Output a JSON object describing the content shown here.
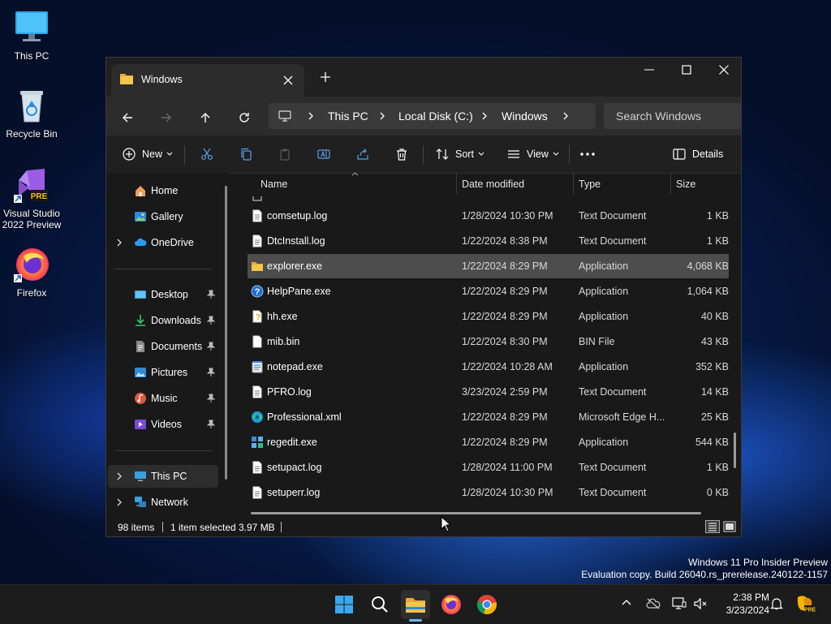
{
  "desktop": {
    "icons": [
      {
        "label": "This PC"
      },
      {
        "label": "Recycle Bin"
      },
      {
        "label": "Visual Studio 2022 Preview"
      },
      {
        "label": "Firefox"
      }
    ],
    "watermark_line1": "Windows 11 Pro Insider Preview",
    "watermark_line2": "Evaluation copy. Build 26040.rs_prerelease.240122-1157"
  },
  "window": {
    "tab_title": "Windows",
    "breadcrumb": [
      "This PC",
      "Local Disk (C:)",
      "Windows"
    ],
    "search_placeholder": "Search Windows",
    "commands": {
      "new": "New",
      "sort": "Sort",
      "view": "View",
      "details": "Details"
    },
    "nav": {
      "home": "Home",
      "gallery": "Gallery",
      "onedrive": "OneDrive",
      "desktop": "Desktop",
      "downloads": "Downloads",
      "documents": "Documents",
      "pictures": "Pictures",
      "music": "Music",
      "videos": "Videos",
      "thispc": "This PC",
      "network": "Network"
    },
    "columns": {
      "name": "Name",
      "date": "Date modified",
      "type": "Type",
      "size": "Size"
    },
    "rows": [
      {
        "name": "comsetup.log",
        "date": "1/28/2024 10:30 PM",
        "type": "Text Document",
        "size": "1 KB",
        "icon": "text-file-icon"
      },
      {
        "name": "DtcInstall.log",
        "date": "1/22/2024 8:38 PM",
        "type": "Text Document",
        "size": "1 KB",
        "icon": "text-file-icon"
      },
      {
        "name": "explorer.exe",
        "date": "1/22/2024 8:29 PM",
        "type": "Application",
        "size": "4,068 KB",
        "icon": "folder-app-icon"
      },
      {
        "name": "HelpPane.exe",
        "date": "1/22/2024 8:29 PM",
        "type": "Application",
        "size": "1,064 KB",
        "icon": "help-icon"
      },
      {
        "name": "hh.exe",
        "date": "1/22/2024 8:29 PM",
        "type": "Application",
        "size": "40 KB",
        "icon": "help-doc-icon"
      },
      {
        "name": "mib.bin",
        "date": "1/22/2024 8:30 PM",
        "type": "BIN File",
        "size": "43 KB",
        "icon": "file-icon"
      },
      {
        "name": "notepad.exe",
        "date": "1/22/2024 10:28 AM",
        "type": "Application",
        "size": "352 KB",
        "icon": "notepad-icon"
      },
      {
        "name": "PFRO.log",
        "date": "3/23/2024 2:59 PM",
        "type": "Text Document",
        "size": "14 KB",
        "icon": "text-file-icon"
      },
      {
        "name": "Professional.xml",
        "date": "1/22/2024 8:29 PM",
        "type": "Microsoft Edge H...",
        "size": "25 KB",
        "icon": "edge-icon"
      },
      {
        "name": "regedit.exe",
        "date": "1/22/2024 8:29 PM",
        "type": "Application",
        "size": "544 KB",
        "icon": "regedit-icon"
      },
      {
        "name": "setupact.log",
        "date": "1/28/2024 11:00 PM",
        "type": "Text Document",
        "size": "1 KB",
        "icon": "text-file-icon"
      },
      {
        "name": "setuperr.log",
        "date": "1/28/2024 10:30 PM",
        "type": "Text Document",
        "size": "0 KB",
        "icon": "text-file-icon"
      }
    ],
    "status": {
      "count": "98 items",
      "selection": "1 item selected",
      "size": "3.97 MB"
    }
  },
  "taskbar": {
    "time": "2:38 PM",
    "date": "3/23/2024"
  }
}
